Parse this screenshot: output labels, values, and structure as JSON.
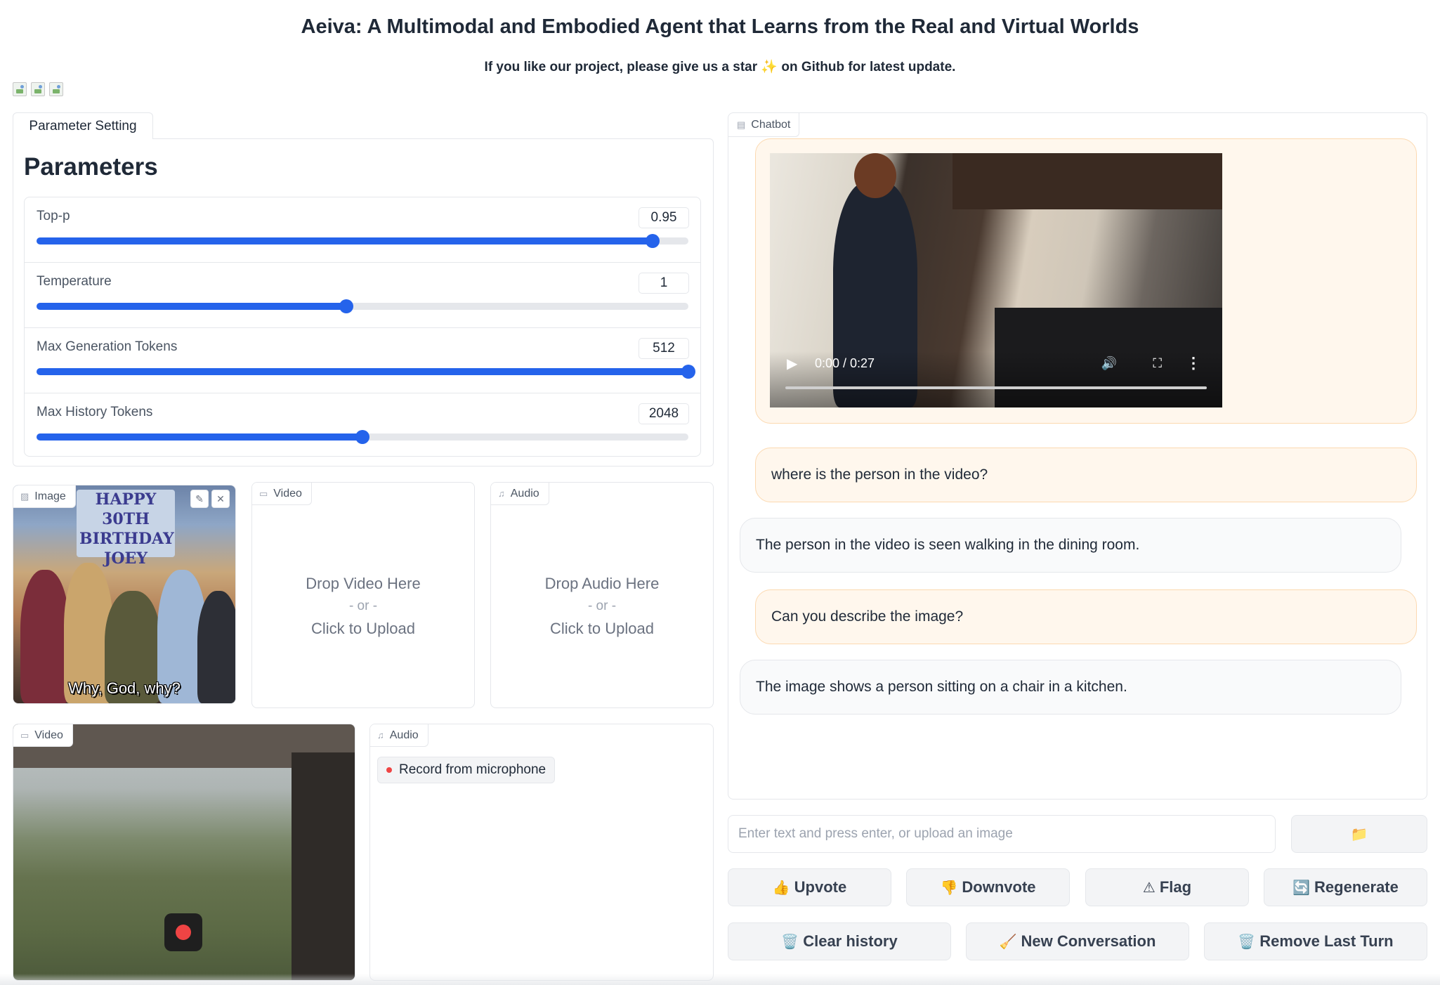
{
  "header": {
    "title": "Aeiva: A Multimodal and Embodied Agent that Learns from the Real and Virtual Worlds",
    "subtitle_before": "If you like our project, please give us a star",
    "subtitle_star": "✨",
    "subtitle_after": "on Github for latest update."
  },
  "parameters": {
    "tab_label": "Parameter Setting",
    "heading": "Parameters",
    "sliders": [
      {
        "label": "Top-p",
        "value": "0.95",
        "fraction": 0.945
      },
      {
        "label": "Temperature",
        "value": "1",
        "fraction": 0.475
      },
      {
        "label": "Max Generation Tokens",
        "value": "512",
        "fraction": 1.0
      },
      {
        "label": "Max History Tokens",
        "value": "2048",
        "fraction": 0.5
      }
    ]
  },
  "uploads": {
    "image": {
      "label": "Image",
      "caption": "Why, God, why?",
      "banner": "HAPPY 30TH BIRTHDAY JOEY",
      "edit_icon": "pencil-icon",
      "clear_icon": "close-icon"
    },
    "video": {
      "label": "Video",
      "drop": "Drop Video Here",
      "or": "- or -",
      "click": "Click to Upload"
    },
    "audio": {
      "label": "Audio",
      "drop": "Drop Audio Here",
      "or": "- or -",
      "click": "Click to Upload"
    },
    "webcam": {
      "label": "Video"
    },
    "mic": {
      "label": "Audio",
      "record": "Record from microphone"
    }
  },
  "chatbot": {
    "label": "Chatbot",
    "video_time": "0:00 / 0:27",
    "messages": [
      {
        "role": "user",
        "text": "where is the person in the video?"
      },
      {
        "role": "bot",
        "text": "The person in the video is seen walking in the dining room."
      },
      {
        "role": "user",
        "text": "Can you describe the image?"
      },
      {
        "role": "bot",
        "text": "The image shows a person sitting on a chair in a kitchen."
      }
    ]
  },
  "input": {
    "placeholder": "Enter text and press enter, or upload an image",
    "upload_icon": "folder-icon"
  },
  "buttons": {
    "upvote": {
      "emoji": "👍",
      "label": "Upvote"
    },
    "downvote": {
      "emoji": "👎",
      "label": "Downvote"
    },
    "flag": {
      "emoji": "⚠",
      "label": "Flag"
    },
    "regenerate": {
      "emoji": "🔄",
      "label": "Regenerate"
    },
    "clear": {
      "emoji": "🗑️",
      "label": "Clear history"
    },
    "new": {
      "emoji": "🧹",
      "label": "New Conversation"
    },
    "remove": {
      "emoji": "🗑️",
      "label": "Remove Last Turn"
    }
  },
  "colors": {
    "accent": "#2563eb",
    "user_bubble": "#fff7ed",
    "bot_bubble": "#f9fafb",
    "record": "#ef4444"
  }
}
